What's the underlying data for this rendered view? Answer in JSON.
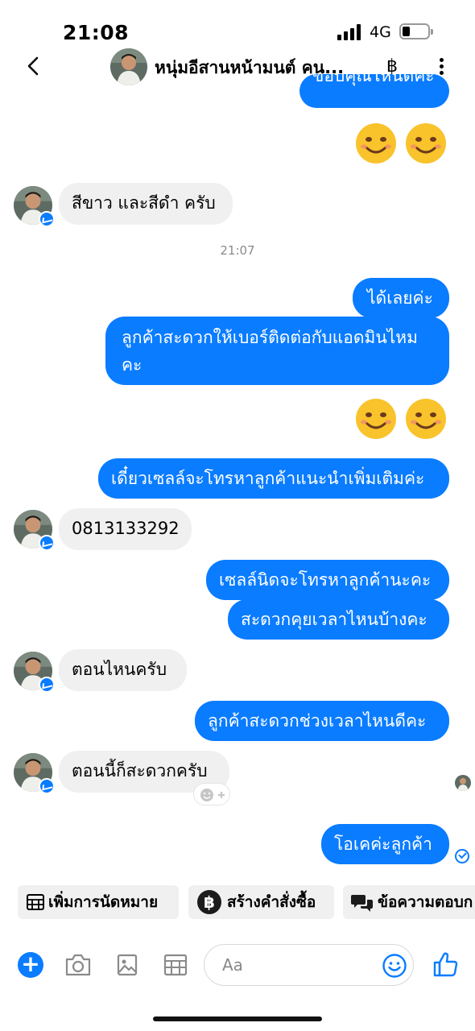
{
  "status_bar": {
    "time": "21:08",
    "network": "4G"
  },
  "header": {
    "title": "หนุ่มอีสานหน้ามนต์ คน...",
    "baht_icon": "฿",
    "avatar_icon": "profile-photo"
  },
  "messages": {
    "m0": {
      "text": "ขอบคุณไหนดีคะ"
    },
    "m1": {
      "text": "สีขาว และสีดำ ครับ"
    },
    "timestamp": "21:07",
    "m2": {
      "text": "ได้เลยค่ะ"
    },
    "m3": {
      "text": "ลูกค้าสะดวกให้เบอร์ติดต่อกับแอดมินไหมคะ"
    },
    "m4": {
      "text": "เดี๋ยวเซลล์จะโทรหาลูกค้าแนะนำเพิ่มเติมค่ะ"
    },
    "m5": {
      "text": "0813133292"
    },
    "m6": {
      "text": "เซลล์นิดจะโทรหาลูกค้านะคะ"
    },
    "m7": {
      "text": "สะดวกคุยเวลาไหนบ้างคะ"
    },
    "m8": {
      "text": "ตอนไหนครับ"
    },
    "m9": {
      "text": "ลูกค้าสะดวกช่วงเวลาไหนดีคะ"
    },
    "m10": {
      "text": "ตอนนี้ก็สะดวกครับ"
    },
    "m11": {
      "text": "โอเคค่ะลูกค้า"
    }
  },
  "quick_actions": {
    "appointment": "เพิ่มการนัดหมาย",
    "order": "สร้างคำสั่งซื้อ",
    "saved_reply": "ข้อความตอบก"
  },
  "composer": {
    "placeholder": "Aa"
  },
  "colors": {
    "accent": "#0a7cff",
    "incoming_bubble": "#f0f0f0",
    "emoji_yellow": "#f9c32c"
  }
}
